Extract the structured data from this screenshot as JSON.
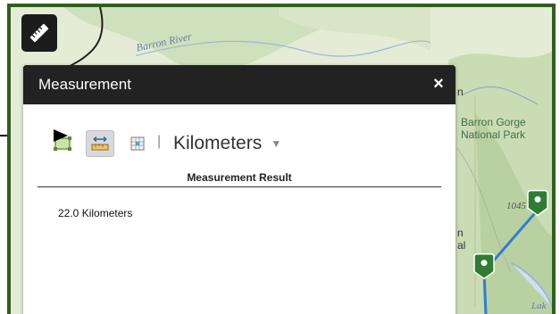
{
  "map": {
    "labels": {
      "river": "Barron River",
      "park": "Barron Gorge\nNational Park",
      "elevation": "1045",
      "edge_fragment_1": "n",
      "edge_fragment_2": "n",
      "edge_fragment_3": "al",
      "lake": "Lak"
    },
    "colors": {
      "route": "#2f7fd1",
      "marker": "#2e7d32",
      "frame": "#2f5f1e"
    }
  },
  "toolbar": {
    "measure_button_icon": "ruler-icon"
  },
  "panel": {
    "title": "Measurement",
    "close_label": "×",
    "tools": [
      {
        "name": "area",
        "icon": "area-icon",
        "active": false
      },
      {
        "name": "distance",
        "icon": "distance-icon",
        "active": true
      },
      {
        "name": "location",
        "icon": "location-icon",
        "active": false
      }
    ],
    "separator": "|",
    "unit": {
      "selected": "Kilometers"
    },
    "result": {
      "title": "Measurement Result",
      "value": "22.0 Kilometers"
    }
  }
}
